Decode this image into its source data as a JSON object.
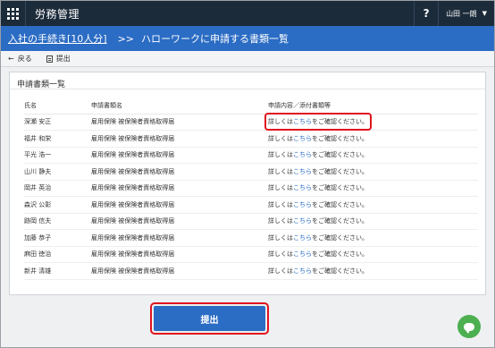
{
  "app": {
    "title": "労務管理",
    "help_label": "?",
    "user_name": "山田 一朗",
    "user_caret": "▼"
  },
  "header": {
    "breadcrumb_link": "入社の手続き[10人分]",
    "separator": ">>",
    "page_title": "ハローワークに申請する書類一覧"
  },
  "toolbar": {
    "back_label": "戻る",
    "back_icon": "←",
    "submit_label": "提出"
  },
  "card": {
    "title": "申請書類一覧",
    "columns": [
      "氏名",
      "申請書類名",
      "申請内容／添付書類等"
    ],
    "rows": [
      {
        "name": "深瀬 安正",
        "document": "雇用保険 被保険者資格取得届",
        "detail_prefix": "詳しくは",
        "detail_link": "こちら",
        "detail_suffix": "をご確認ください。"
      },
      {
        "name": "福井 和栄",
        "document": "雇用保険 被保険者資格取得届",
        "detail_prefix": "詳しくは",
        "detail_link": "こちら",
        "detail_suffix": "をご確認ください。"
      },
      {
        "name": "平光 浩一",
        "document": "雇用保険 被保険者資格取得届",
        "detail_prefix": "詳しくは",
        "detail_link": "こちら",
        "detail_suffix": "をご確認ください。"
      },
      {
        "name": "山川 静夫",
        "document": "雇用保険 被保険者資格取得届",
        "detail_prefix": "詳しくは",
        "detail_link": "こちら",
        "detail_suffix": "をご確認ください。"
      },
      {
        "name": "岡井 英治",
        "document": "雇用保険 被保険者資格取得届",
        "detail_prefix": "詳しくは",
        "detail_link": "こちら",
        "detail_suffix": "をご確認ください。"
      },
      {
        "name": "森沢 公彰",
        "document": "雇用保険 被保険者資格取得届",
        "detail_prefix": "詳しくは",
        "detail_link": "こちら",
        "detail_suffix": "をご確認ください。"
      },
      {
        "name": "跡岡 信夫",
        "document": "雇用保険 被保険者資格取得届",
        "detail_prefix": "詳しくは",
        "detail_link": "こちら",
        "detail_suffix": "をご確認ください。"
      },
      {
        "name": "加藤 恭子",
        "document": "雇用保険 被保険者資格取得届",
        "detail_prefix": "詳しくは",
        "detail_link": "こちら",
        "detail_suffix": "をご確認ください。"
      },
      {
        "name": "麻田 徳治",
        "document": "雇用保険 被保険者資格取得届",
        "detail_prefix": "詳しくは",
        "detail_link": "こちら",
        "detail_suffix": "をご確認ください。"
      },
      {
        "name": "新井 清雄",
        "document": "雇用保険 被保険者資格取得届",
        "detail_prefix": "詳しくは",
        "detail_link": "こちら",
        "detail_suffix": "をご確認ください。"
      }
    ]
  },
  "submit": {
    "label": "提出"
  },
  "icons": {
    "apps": "grid-icon",
    "back": "arrow-left-icon",
    "submit": "document-icon",
    "chat": "chat-icon"
  },
  "colors": {
    "topbar": "#1c2b3a",
    "header": "#2b6cc4",
    "accent": "#2b6cc4",
    "highlight": "#e0141e",
    "chat": "#4caf50"
  }
}
